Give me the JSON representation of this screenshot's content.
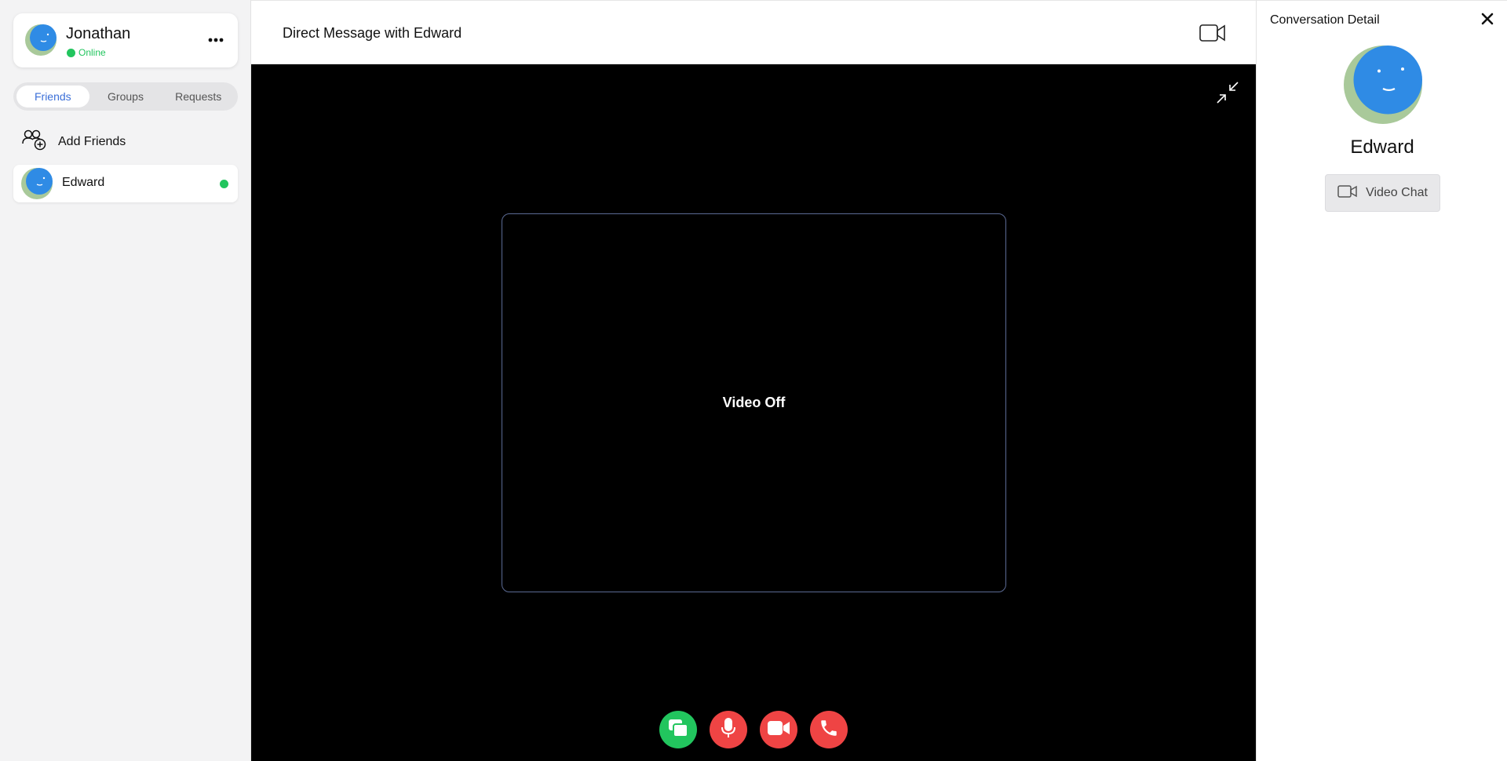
{
  "user": {
    "name": "Jonathan",
    "status": "Online"
  },
  "tabs": [
    {
      "label": "Friends",
      "active": true
    },
    {
      "label": "Groups",
      "active": false
    },
    {
      "label": "Requests",
      "active": false
    }
  ],
  "add_friends": {
    "label": "Add Friends"
  },
  "friends": [
    {
      "name": "Edward",
      "online": true
    }
  ],
  "header": {
    "title": "Direct Message with Edward"
  },
  "video": {
    "status_text": "Video Off"
  },
  "controls": [
    {
      "name": "share-screen-button",
      "icon": "screen-share-icon",
      "color": "#22c55e"
    },
    {
      "name": "mute-mic-button",
      "icon": "microphone-icon",
      "color": "#ef4444"
    },
    {
      "name": "toggle-camera-button",
      "icon": "video-camera-icon",
      "color": "#ef4444"
    },
    {
      "name": "end-call-button",
      "icon": "phone-hangup-icon",
      "color": "#ef4444"
    }
  ],
  "panel": {
    "title": "Conversation Detail",
    "contact_name": "Edward",
    "video_chat_label": "Video Chat"
  },
  "colors": {
    "accent": "#3b6fd8",
    "online": "#22c55e",
    "danger": "#ef4444",
    "avatar_blue": "#2f8be5",
    "avatar_green": "#a9c99a"
  }
}
